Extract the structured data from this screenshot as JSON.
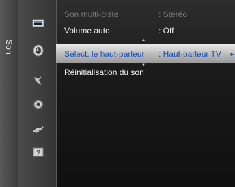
{
  "sidebar": {
    "title": "Son"
  },
  "categories": [
    {
      "icon": "picture-icon",
      "active": false
    },
    {
      "icon": "speaker-icon",
      "active": true
    },
    {
      "icon": "satellite-dish-icon",
      "active": false
    },
    {
      "icon": "gear-icon",
      "active": false
    },
    {
      "icon": "input-plug-icon",
      "active": false
    },
    {
      "icon": "help-icon",
      "glyph": "?",
      "active": false
    }
  ],
  "menu": {
    "items": [
      {
        "label": "Son multi-piste",
        "value": ": Stéréo",
        "state": "disabled"
      },
      {
        "label": "Volume auto",
        "value": ": Off",
        "state": "normal"
      },
      {
        "label": "Sélect. le haut-parleur",
        "value": ": Haut-parleur TV",
        "state": "highlighted",
        "arrow": "►"
      },
      {
        "label": "Réinitialisation du son",
        "value": "",
        "state": "normal"
      }
    ],
    "scroll_up_glyph": "▲",
    "scroll_down_glyph": "▼"
  },
  "colors": {
    "highlight_text": "#1a4fb5",
    "disabled_text": "#7a7a7a",
    "normal_text": "#f2f2f2"
  }
}
